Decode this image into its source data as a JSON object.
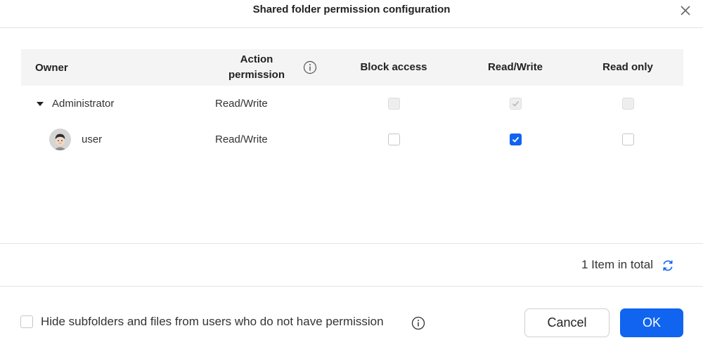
{
  "dialog": {
    "title": "Shared folder permission configuration"
  },
  "table": {
    "columns": {
      "owner": "Owner",
      "action_permission": "Action permission",
      "block_access": "Block access",
      "read_write": "Read/Write",
      "read_only": "Read only"
    },
    "rows": [
      {
        "name": "Administrator",
        "action_permission": "Read/Write",
        "block_access": false,
        "read_write": true,
        "read_only": false,
        "disabled": true,
        "expanded": true
      },
      {
        "name": "user",
        "action_permission": "Read/Write",
        "block_access": false,
        "read_write": true,
        "read_only": false,
        "disabled": false
      }
    ]
  },
  "footer": {
    "total_text": "1 Item in total",
    "hide_label": "Hide subfolders and files from users who do not have permission",
    "hide_checked": false,
    "cancel_label": "Cancel",
    "ok_label": "OK"
  },
  "colors": {
    "accent": "#1064f0",
    "header_bg": "#f4f4f4"
  }
}
